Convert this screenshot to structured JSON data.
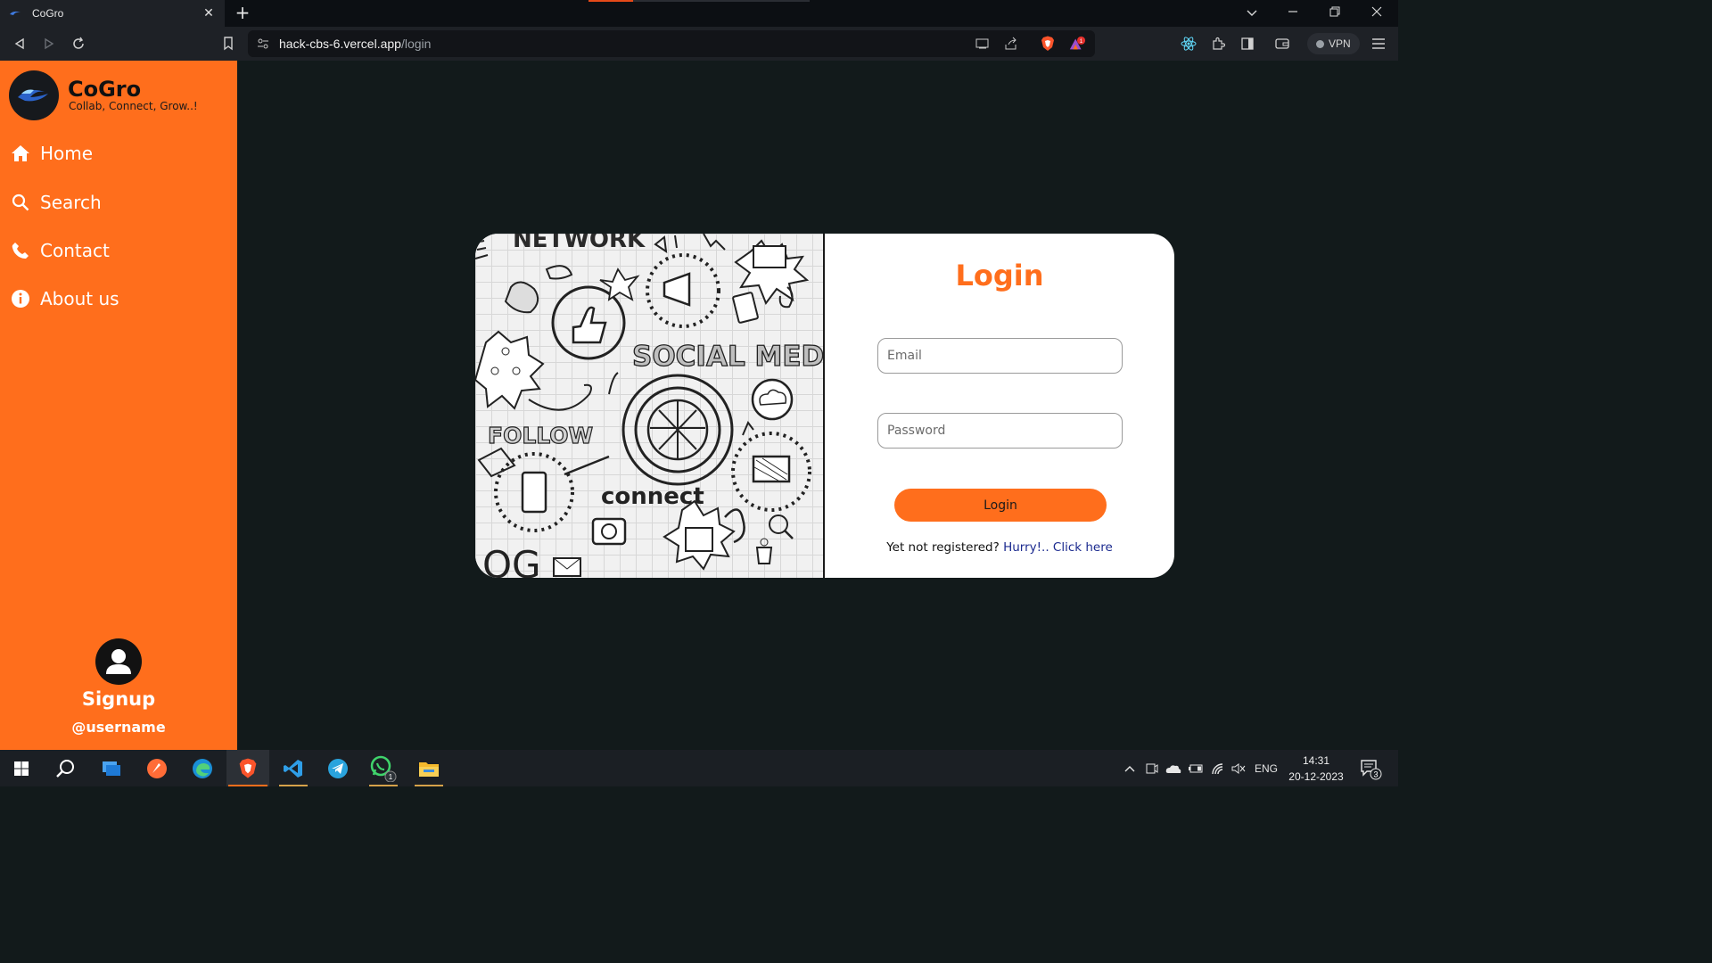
{
  "browser": {
    "tab_title": "CoGro",
    "tab_close": "✕",
    "new_tab": "+",
    "url_host": "hack-cbs-6.vercel.app",
    "url_path": "/login",
    "vpn_label": "VPN",
    "brave_badge": "1"
  },
  "sidebar": {
    "brand": "CoGro",
    "tagline": "Collab, Connect, Grow..!",
    "items": [
      {
        "label": "Home",
        "icon": "home-icon"
      },
      {
        "label": "Search",
        "icon": "search-icon"
      },
      {
        "label": "Contact",
        "icon": "phone-icon"
      },
      {
        "label": "About us",
        "icon": "info-icon"
      }
    ],
    "profile": {
      "signup": "Signup",
      "username": "@username"
    }
  },
  "login": {
    "title": "Login",
    "email_placeholder": "Email",
    "password_placeholder": "Password",
    "button": "Login",
    "register_text": "Yet not registered?",
    "register_link": "Hurry!.. Click here"
  },
  "art": {
    "network": "NETWORK",
    "social_media": "SOCIAL MEDIA",
    "follow": "FOLLOW",
    "connect": "connect",
    "blog": "OG"
  },
  "taskbar": {
    "language": "ENG",
    "time": "14:31",
    "date": "20-12-2023",
    "notifications": "3",
    "whatsapp_badge": "1"
  },
  "colors": {
    "accent": "#ff6e1c",
    "page_bg": "#121a1b",
    "link": "#1b2a8f"
  }
}
